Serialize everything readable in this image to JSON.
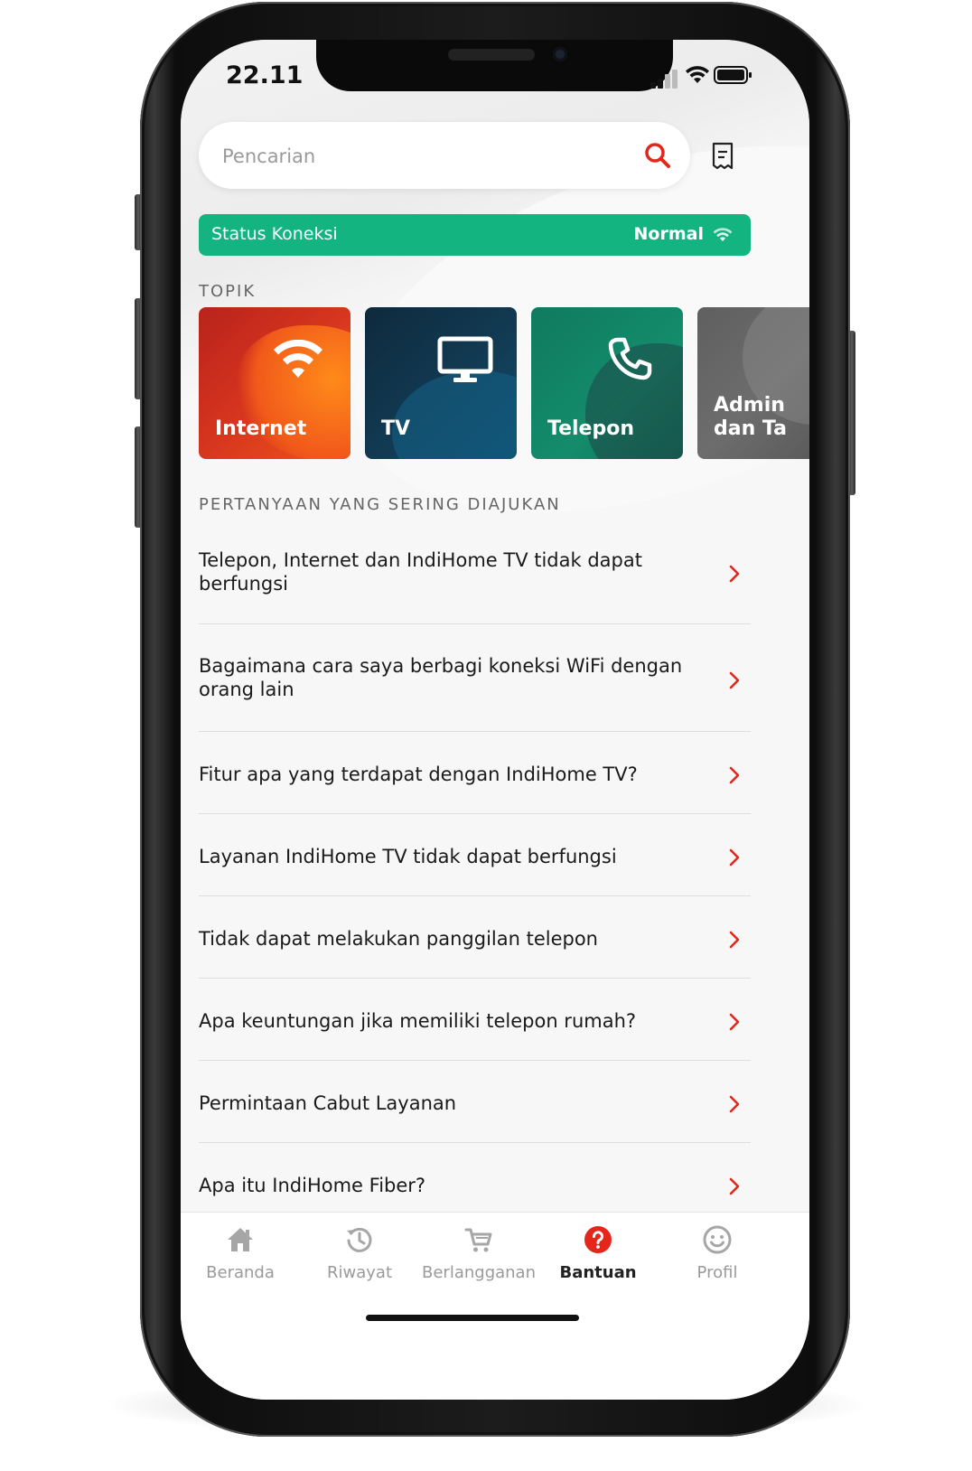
{
  "status_bar": {
    "time": "22.11"
  },
  "search": {
    "placeholder": "Pencarian"
  },
  "connection": {
    "label": "Status Koneksi",
    "value": "Normal",
    "color": "#13b480"
  },
  "topics": {
    "title": "TOPIK",
    "items": [
      {
        "label": "Internet",
        "icon": "wifi-icon"
      },
      {
        "label": "TV",
        "icon": "monitor-icon"
      },
      {
        "label": "Telepon",
        "icon": "phone-icon"
      },
      {
        "label": "Admin dan Ta",
        "icon": "none"
      }
    ]
  },
  "faq": {
    "title": "PERTANYAAN YANG SERING DIAJUKAN",
    "items": [
      "Telepon, Internet dan IndiHome TV tidak dapat berfungsi",
      "Bagaimana cara saya berbagi koneksi WiFi dengan orang lain",
      "Fitur apa yang terdapat dengan IndiHome TV?",
      "Layanan IndiHome TV tidak dapat berfungsi",
      "Tidak dapat melakukan panggilan telepon",
      "Apa keuntungan jika memiliki telepon rumah?",
      "Permintaan Cabut Layanan",
      "Apa itu IndiHome Fiber?"
    ]
  },
  "tabbar": {
    "items": [
      {
        "label": "Beranda",
        "icon": "home-icon"
      },
      {
        "label": "Riwayat",
        "icon": "history-icon"
      },
      {
        "label": "Berlangganan",
        "icon": "cart-icon"
      },
      {
        "label": "Bantuan",
        "icon": "help-icon",
        "active": true
      },
      {
        "label": "Profil",
        "icon": "smile-icon"
      }
    ]
  },
  "colors": {
    "accent": "#e4261b",
    "green": "#13b480"
  }
}
